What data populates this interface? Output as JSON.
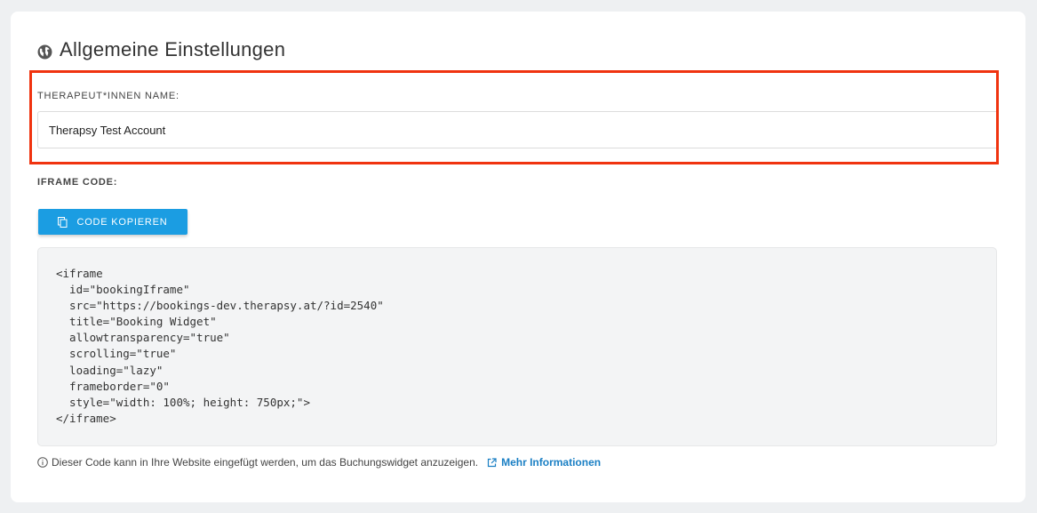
{
  "section": {
    "title": "Allgemeine Einstellungen",
    "icon": "globe-icon"
  },
  "therapist_name": {
    "label": "THERAPEUT*INNEN NAME:",
    "value": "Therapsy Test Account"
  },
  "iframe_code": {
    "label": "IFRAME CODE:",
    "copy_button_label": "CODE KOPIEREN",
    "copy_icon": "copy-icon",
    "code": "<iframe\n  id=\"bookingIframe\"\n  src=\"https://bookings-dev.therapsy.at/?id=2540\"\n  title=\"Booking Widget\"\n  allowtransparency=\"true\"\n  scrolling=\"true\"\n  loading=\"lazy\"\n  frameborder=\"0\"\n  style=\"width: 100%; height: 750px;\">\n</iframe>"
  },
  "info": {
    "text": "Dieser Code kann in Ihre Website eingefügt werden, um das Buchungswidget anzuzeigen.",
    "link_label": "Mehr Informationen",
    "info_icon": "info-icon",
    "link_icon": "external-link-icon"
  },
  "colors": {
    "accent": "#1b9de2",
    "highlight": "#f0330f",
    "link": "#1a7fc4"
  }
}
